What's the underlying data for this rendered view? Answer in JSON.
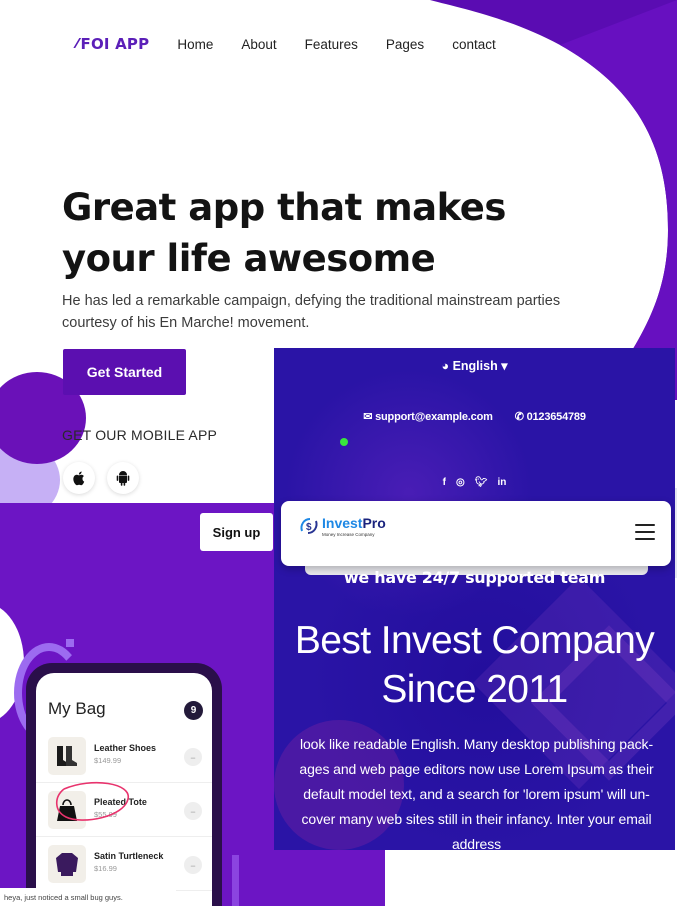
{
  "panel_foi": {
    "logo": "FOI APP",
    "logo_icon": "slash-pattern-icon",
    "nav": [
      "Home",
      "About",
      "Features",
      "Pages",
      "contact"
    ],
    "hero_title": "Great app that makes your life awesome",
    "hero_subtitle": "He has led a remarkable campaign, defying the traditional mainstream parties courtesy of his En Marche! movement.",
    "cta": "Get Started",
    "mobile_label": "GET OUR MOBILE APP",
    "store_icons": [
      "apple-icon",
      "android-icon"
    ],
    "accent": "#5b0fb0"
  },
  "panel_bag": {
    "signup": "Sign up",
    "title": "My Bag",
    "count": "9",
    "items": [
      {
        "name": "Leather Shoes",
        "price": "$149.99"
      },
      {
        "name": "Pleated Tote",
        "price": "$55.99"
      },
      {
        "name": "Satin Turtleneck",
        "price": "$16.99"
      }
    ],
    "comment": "heya, just noticed a small bug guys.",
    "background": "#6c15c4"
  },
  "panel_invest": {
    "language": "English",
    "email": "support@example.com",
    "phone": "0123654789",
    "social": [
      "facebook-icon",
      "instagram-icon",
      "twitter-icon",
      "linkedin-icon"
    ],
    "brand_prefix": "Invest",
    "brand_suffix": "Pro",
    "brand_tagline": "Money Increase Company",
    "support_line": "we have 24/7 supported team",
    "title_line1": "Best Invest Company",
    "title_line2": "Since 2011",
    "body": "look like readable English. Many desktop publishing pack-ages and web page editors now use Lorem Ipsum as their default model text, and a search for 'lorem ipsum' will un-cover many web sites still in their infancy. Inter your email address",
    "background": "#2a14a6"
  }
}
